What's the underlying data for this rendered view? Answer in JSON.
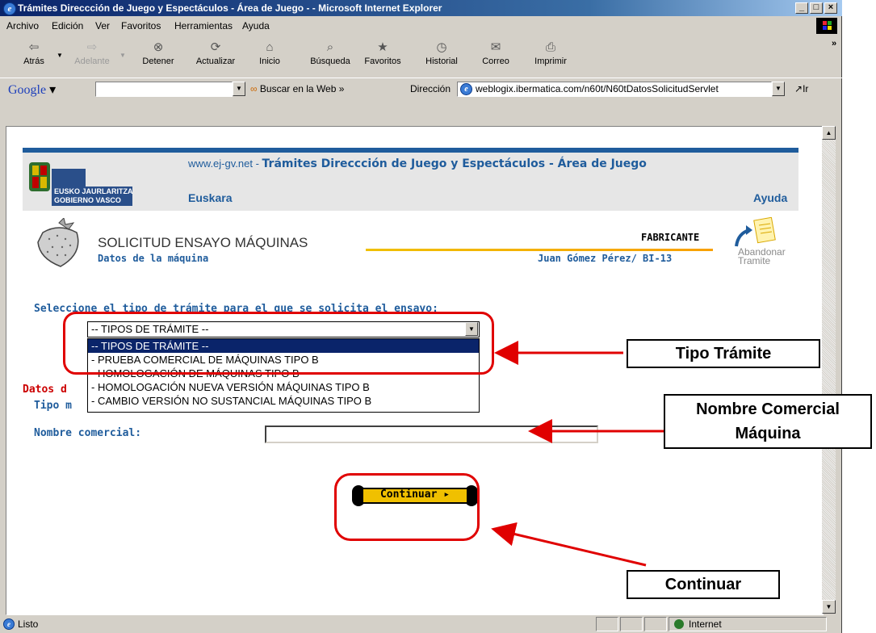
{
  "window": {
    "title": "Trámites Direccción de Juego y Espectáculos - Área de Juego - - Microsoft Internet Explorer"
  },
  "menu": [
    "Archivo",
    "Edición",
    "Ver",
    "Favoritos",
    "Herramientas",
    "Ayuda"
  ],
  "toolbar": {
    "back": "Atrás",
    "forward": "Adelante",
    "stop": "Detener",
    "refresh": "Actualizar",
    "home": "Inicio",
    "search": "Búsqueda",
    "favorites": "Favoritos",
    "history": "Historial",
    "mail": "Correo",
    "print": "Imprimir"
  },
  "google": {
    "label": "Google",
    "search_web": "Buscar en la Web",
    "search_value": ""
  },
  "address": {
    "label": "Dirección",
    "url": "weblogix.ibermatica.com/n60t/N60tDatosSolicitudServlet",
    "go": "Ir"
  },
  "page": {
    "logo_line1": "EUSKO JAURLARITZA",
    "logo_line2": "GOBIERNO VASCO",
    "site": "www.ej-gv.net",
    "site_sep": " - ",
    "header_title": "Trámites Direccción de Juego y Espectáculos - Área de Juego",
    "euskara": "Euskara",
    "help": "Ayuda",
    "solicitud_title": "SOLICITUD ENSAYO MÁQUINAS",
    "subtitle": "Datos de la máquina",
    "role": "FABRICANTE",
    "person": "Juan Gómez Pérez/ BI-13",
    "abandon_line1": "Abandonar",
    "abandon_line2": "Tramite",
    "select_question": "Seleccione el tipo de trámite para el que se solicita el ensayo:",
    "select_value": "-- TIPOS DE TRÁMITE --",
    "options": [
      "-- TIPOS DE TRÁMITE --",
      "- PRUEBA COMERCIAL DE MÁQUINAS TIPO B",
      "- HOMOLOGACIÓN DE MÁQUINAS  TIPO B",
      "- HOMOLOGACIÓN NUEVA VERSIÓN MÁQUINAS TIPO B",
      "- CAMBIO VERSIÓN NO SUSTANCIAL MÁQUINAS TIPO B"
    ],
    "datos_label": "Datos d",
    "tipo_label": "Tipo m",
    "nombre_label": "Nombre comercial:",
    "nombre_value": "",
    "continue": "Continuar ▸"
  },
  "annotations": {
    "tipo_tramite": "Tipo Trámite",
    "nombre_comercial_l1": "Nombre Comercial",
    "nombre_comercial_l2": "Máquina",
    "continuar": "Continuar"
  },
  "status": {
    "left": "Listo",
    "zone": "Internet"
  },
  "colors": {
    "annotation_red": "#e00000",
    "brand_blue": "#1f5c9c",
    "accent_yellow": "#f0c000"
  }
}
